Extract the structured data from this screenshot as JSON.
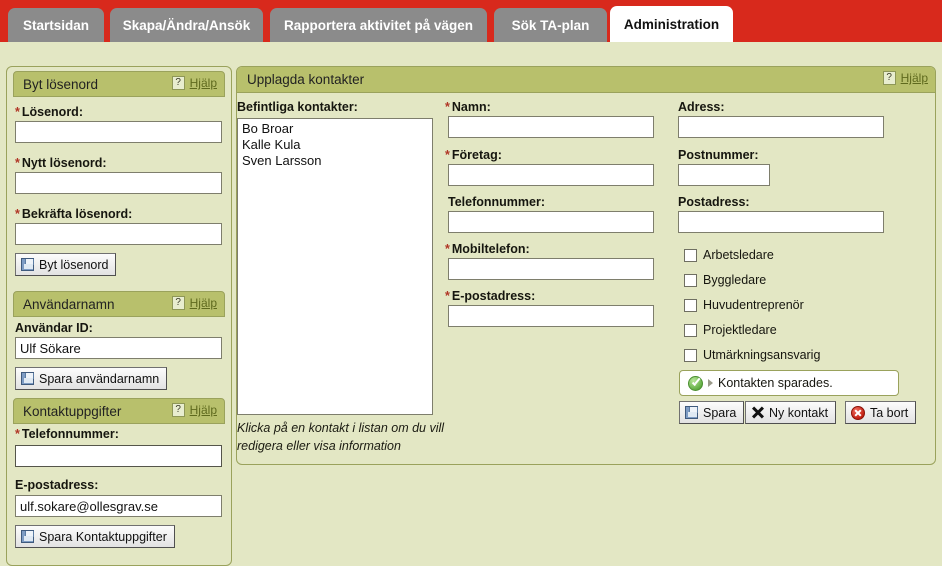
{
  "tabs": [
    {
      "label": "Startsidan",
      "active": false
    },
    {
      "label": "Skapa/Ändra/Ansök",
      "active": false
    },
    {
      "label": "Rapportera aktivitet på vägen",
      "active": false
    },
    {
      "label": "Sök TA-plan",
      "active": false
    },
    {
      "label": "Administration",
      "active": true
    }
  ],
  "help_label": "Hjälp",
  "help_qmark": "?",
  "left_panel": {
    "password_section": {
      "title": "Byt lösenord",
      "fields": [
        {
          "label": "Lösenord:",
          "required": true,
          "value": ""
        },
        {
          "label": "Nytt lösenord:",
          "required": true,
          "value": ""
        },
        {
          "label": "Bekräfta lösenord:",
          "required": true,
          "value": ""
        }
      ],
      "button": "Byt lösenord"
    },
    "username_section": {
      "title": "Användarnamn",
      "field_label": "Användar ID:",
      "field_value": "Ulf Sökare",
      "button": "Spara användarnamn"
    },
    "contact_section": {
      "title": "Kontaktuppgifter",
      "phone_label": "Telefonnummer:",
      "phone_required": true,
      "phone_value": "",
      "email_label": "E-postadress:",
      "email_value": "ulf.sokare@ollesgrav.se",
      "button": "Spara Kontaktuppgifter"
    }
  },
  "main_panel": {
    "title": "Upplagda kontakter",
    "list_label": "Befintliga kontakter:",
    "contacts": [
      "Bo Broar",
      "Kalle Kula",
      "Sven Larsson"
    ],
    "hint": "Klicka på en kontakt i listan om du vill redigera eller visa information",
    "middle_fields": [
      {
        "label": "Namn:",
        "required": true,
        "value": ""
      },
      {
        "label": "Företag:",
        "required": true,
        "value": ""
      },
      {
        "label": "Telefonnummer:",
        "required": false,
        "value": ""
      },
      {
        "label": "Mobiltelefon:",
        "required": true,
        "value": ""
      },
      {
        "label": "E-postadress:",
        "required": true,
        "value": ""
      }
    ],
    "right_fields": [
      {
        "label": "Adress:",
        "required": false,
        "value": ""
      },
      {
        "label": "Postnummer:",
        "required": false,
        "value": ""
      },
      {
        "label": "Postadress:",
        "required": false,
        "value": ""
      }
    ],
    "roles": [
      {
        "label": "Arbetsledare",
        "checked": false
      },
      {
        "label": "Byggledare",
        "checked": false
      },
      {
        "label": "Huvudentreprenör",
        "checked": false
      },
      {
        "label": "Projektledare",
        "checked": false
      },
      {
        "label": "Utmärkningsansvarig",
        "checked": false
      }
    ],
    "status_message": "Kontakten sparades.",
    "buttons": {
      "save": "Spara",
      "new": "Ny kontakt",
      "delete": "Ta bort"
    }
  },
  "colors": {
    "header_red": "#d8291c",
    "tab_gray": "#8b8b8b",
    "panel_bg": "#e3e7c4",
    "panel_head": "#b8c06c",
    "panel_border": "#9aa25c",
    "required_star": "#b03525",
    "help_link": "#5f6a1e",
    "success_green": "#5aa83c",
    "delete_red": "#c01d10"
  }
}
